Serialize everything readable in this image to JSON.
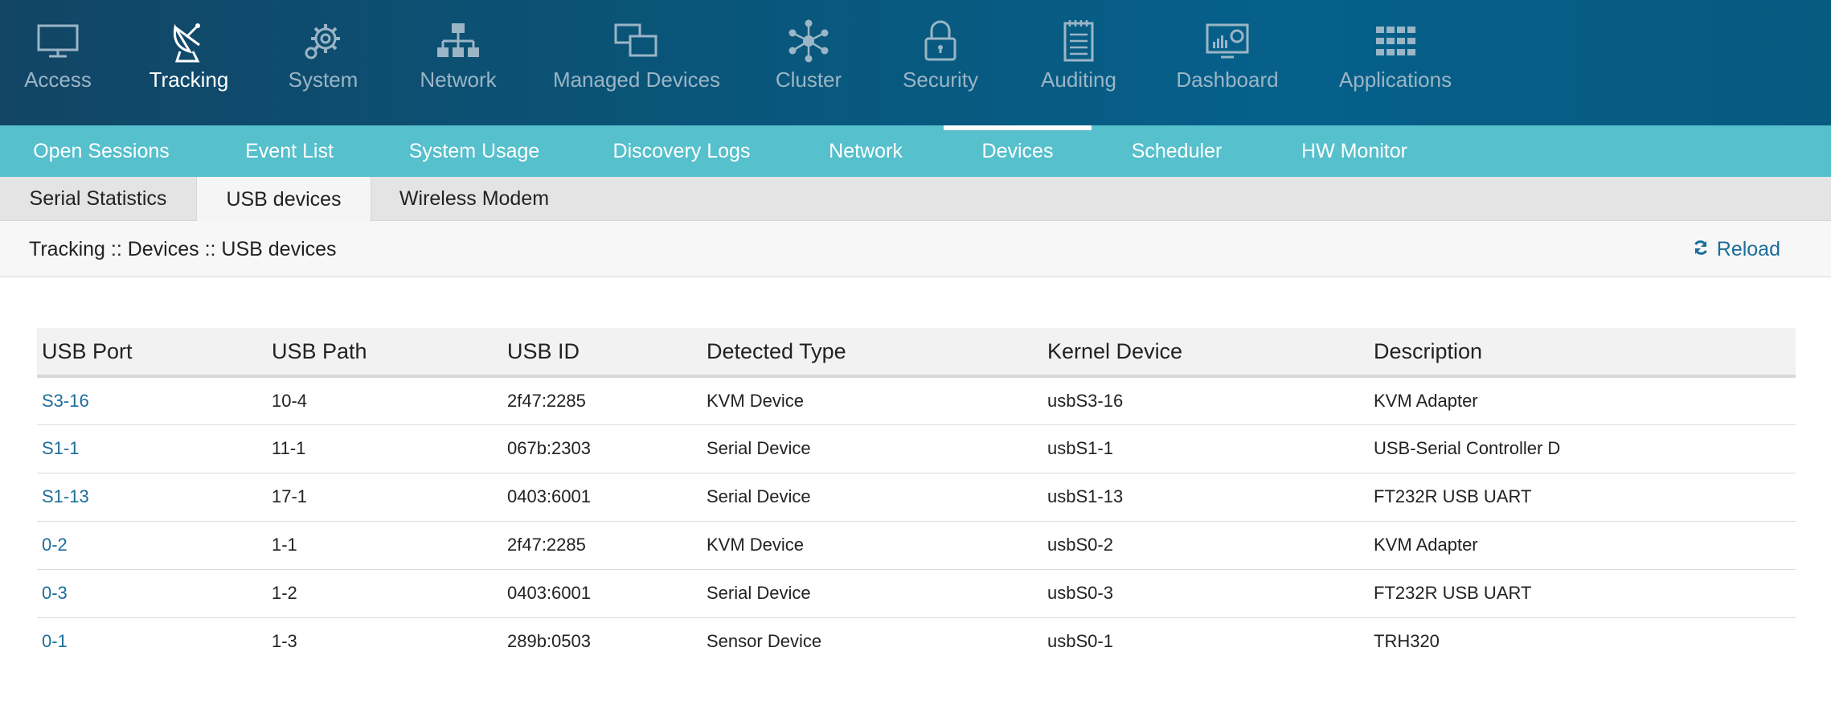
{
  "topnav": {
    "items": [
      {
        "label": "Access",
        "icon": "monitor-icon"
      },
      {
        "label": "Tracking",
        "icon": "satellite-dish-icon",
        "active": true
      },
      {
        "label": "System",
        "icon": "gear-icon"
      },
      {
        "label": "Network",
        "icon": "network-tree-icon"
      },
      {
        "label": "Managed Devices",
        "icon": "windows-stack-icon"
      },
      {
        "label": "Cluster",
        "icon": "cluster-hub-icon"
      },
      {
        "label": "Security",
        "icon": "lock-icon"
      },
      {
        "label": "Auditing",
        "icon": "notepad-icon"
      },
      {
        "label": "Dashboard",
        "icon": "dashboard-chart-icon"
      },
      {
        "label": "Applications",
        "icon": "grid-apps-icon"
      }
    ]
  },
  "subnav": {
    "tabs": [
      {
        "label": "Open Sessions"
      },
      {
        "label": "Event List"
      },
      {
        "label": "System Usage"
      },
      {
        "label": "Discovery Logs"
      },
      {
        "label": "Network"
      },
      {
        "label": "Devices",
        "active": true
      },
      {
        "label": "Scheduler"
      },
      {
        "label": "HW Monitor"
      }
    ]
  },
  "tertiary": {
    "tabs": [
      {
        "label": "Serial Statistics"
      },
      {
        "label": "USB devices",
        "active": true
      },
      {
        "label": "Wireless Modem"
      }
    ]
  },
  "breadcrumb": "Tracking :: Devices :: USB devices",
  "reload_label": "Reload",
  "table": {
    "headers": [
      "USB Port",
      "USB Path",
      "USB ID",
      "Detected Type",
      "Kernel Device",
      "Description"
    ],
    "rows": [
      [
        "S3-16",
        "10-4",
        "2f47:2285",
        "KVM Device",
        "usbS3-16",
        "KVM Adapter"
      ],
      [
        "S1-1",
        "11-1",
        "067b:2303",
        "Serial Device",
        "usbS1-1",
        "USB-Serial Controller D"
      ],
      [
        "S1-13",
        "17-1",
        "0403:6001",
        "Serial Device",
        "usbS1-13",
        "FT232R USB UART"
      ],
      [
        "0-2",
        "1-1",
        "2f47:2285",
        "KVM Device",
        "usbS0-2",
        "KVM Adapter"
      ],
      [
        "0-3",
        "1-2",
        "0403:6001",
        "Serial Device",
        "usbS0-3",
        "FT232R USB UART"
      ],
      [
        "0-1",
        "1-3",
        "289b:0503",
        "Sensor Device",
        "usbS0-1",
        "TRH320"
      ]
    ]
  },
  "colors": {
    "topnav_bg": "#0a5478",
    "subnav_bg": "#56c0cc",
    "link": "#1a6d9b"
  }
}
